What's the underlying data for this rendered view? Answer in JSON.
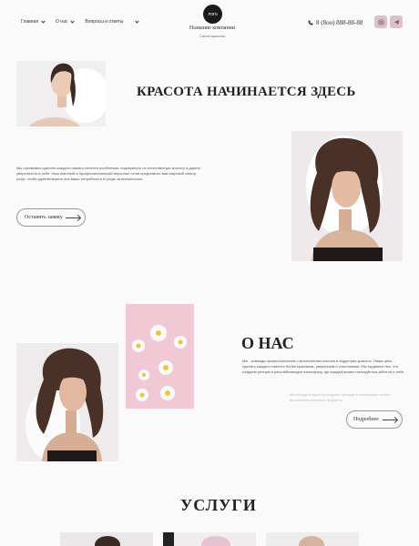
{
  "header": {
    "nav": [
      {
        "label": "Главная",
        "has_dropdown": true
      },
      {
        "label": "О нас",
        "has_dropdown": true
      },
      {
        "label": "Вопросы и ответы",
        "has_dropdown": false
      }
    ],
    "logo_label": "лого",
    "company_name": "Название компании",
    "tagline": "Салон красоты",
    "phone": "8 (8oo) 888-88-88",
    "icons": [
      "phone-icon",
      "instagram-icon",
      "telegram-icon"
    ],
    "accent_color": "#dcc0cc"
  },
  "hero": {
    "title": "КРАСОТА НАЧИНАЕТСЯ ЗДЕСЬ",
    "paragraph": "Мы стремимся сделать каждого нашего клиента особенным, подчеркнуть их естественную красоту и дарить уверенность в себе. Наш опытный и профессиональный персонал готов предложить вам широкий спектр услуг, чтобы удовлетворить все ваши потребности в уходе за внешностью.",
    "button_label": "Оставить заявку"
  },
  "about": {
    "title": "О НАС",
    "paragraph": "Мы - команда профессионалов с многолетним опытом в индустрии красоты. Наша цель - сделать каждого клиента более красивым, уверенным и счастливым. Мы гордимся тем, что создаем уютную и расслабляющую атмосферу, где каждый может насладиться заботой о себе.",
    "faded_paragraph": "Мы всегда в курсе последних трендов и используем только высококачественные продукты.",
    "button_label": "Подробнее"
  },
  "services": {
    "title": "УСЛУГИ"
  }
}
